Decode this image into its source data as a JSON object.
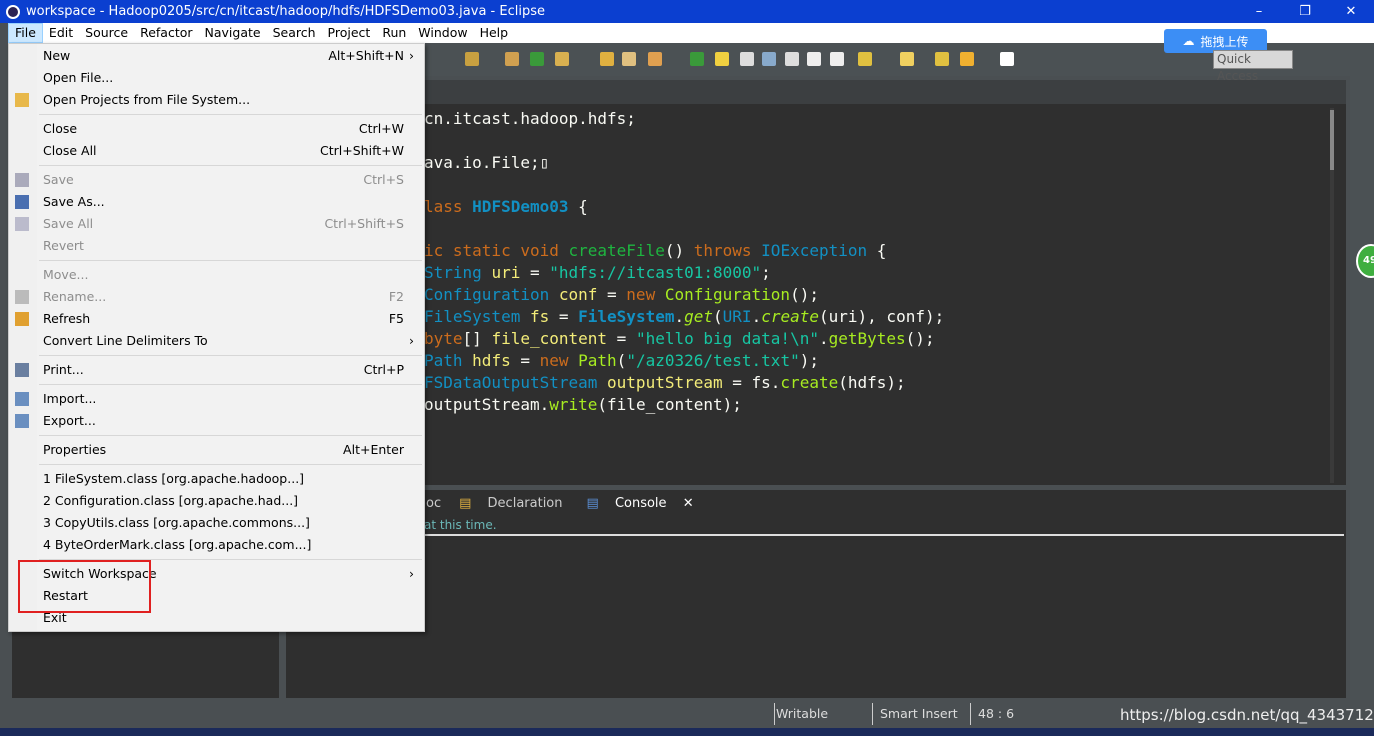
{
  "window": {
    "title": "workspace - Hadoop0205/src/cn/itcast/hadoop/hdfs/HDFSDemo03.java - Eclipse",
    "minimize": "–",
    "maximize": "❐",
    "close": "✕"
  },
  "menubar": [
    "File",
    "Edit",
    "Source",
    "Refactor",
    "Navigate",
    "Search",
    "Project",
    "Run",
    "Window",
    "Help"
  ],
  "toolbar": {
    "quick_access": "Quick Access",
    "upload_label": "拖拽上传"
  },
  "file_menu": [
    {
      "label": "New",
      "shortcut": "Alt+Shift+N",
      "submenu": true,
      "enabled": true
    },
    {
      "label": "Open File...",
      "enabled": true
    },
    {
      "label": "Open Projects from File System...",
      "enabled": true,
      "icon": "folder-icon"
    },
    {
      "sep": true
    },
    {
      "label": "Close",
      "shortcut": "Ctrl+W",
      "enabled": true
    },
    {
      "label": "Close All",
      "shortcut": "Ctrl+Shift+W",
      "enabled": true
    },
    {
      "sep": true
    },
    {
      "label": "Save",
      "shortcut": "Ctrl+S",
      "enabled": false,
      "icon": "save-icon"
    },
    {
      "label": "Save As...",
      "enabled": true,
      "icon": "save-as-icon"
    },
    {
      "label": "Save All",
      "shortcut": "Ctrl+Shift+S",
      "enabled": false,
      "icon": "save-all-icon"
    },
    {
      "label": "Revert",
      "enabled": false
    },
    {
      "sep": true
    },
    {
      "label": "Move...",
      "enabled": false
    },
    {
      "label": "Rename...",
      "shortcut": "F2",
      "enabled": false,
      "icon": "rename-icon"
    },
    {
      "label": "Refresh",
      "shortcut": "F5",
      "enabled": true,
      "icon": "refresh-icon"
    },
    {
      "label": "Convert Line Delimiters To",
      "submenu": true,
      "enabled": true
    },
    {
      "sep": true
    },
    {
      "label": "Print...",
      "shortcut": "Ctrl+P",
      "enabled": true,
      "icon": "print-icon"
    },
    {
      "sep": true
    },
    {
      "label": "Import...",
      "enabled": true,
      "icon": "import-icon"
    },
    {
      "label": "Export...",
      "enabled": true,
      "icon": "export-icon"
    },
    {
      "sep": true
    },
    {
      "label": "Properties",
      "shortcut": "Alt+Enter",
      "enabled": true
    },
    {
      "sep": true
    },
    {
      "label": "1 FileSystem.class  [org.apache.hadoop...]",
      "enabled": true
    },
    {
      "label": "2 Configuration.class  [org.apache.had...]",
      "enabled": true
    },
    {
      "label": "3 CopyUtils.class  [org.apache.commons...]",
      "enabled": true
    },
    {
      "label": "4 ByteOrderMark.class  [org.apache.com...]",
      "enabled": true
    },
    {
      "sep": true
    },
    {
      "label": "Switch Workspace",
      "submenu": true,
      "enabled": true
    },
    {
      "label": "Restart",
      "enabled": true
    },
    {
      "label": "Exit",
      "enabled": true
    }
  ],
  "editor": {
    "lines": [
      [
        [
          "cn.itcast.hadoop.hdfs;",
          ""
        ]
      ],
      [],
      [
        [
          "ava.io.File;",
          ""
        ],
        [
          "▯",
          ""
        ]
      ],
      [],
      [
        [
          "lass ",
          "k"
        ],
        [
          "HDFSDemo03",
          "t b"
        ],
        [
          " {",
          ""
        ]
      ],
      [],
      [
        [
          "ic static void ",
          "k"
        ],
        [
          "createFile",
          "m"
        ],
        [
          "() ",
          ""
        ],
        [
          "throws ",
          "k"
        ],
        [
          "IOException",
          "t"
        ],
        [
          " {",
          ""
        ]
      ],
      [
        [
          "String ",
          "t"
        ],
        [
          "uri",
          "l"
        ],
        [
          " = ",
          ""
        ],
        [
          "\"hdfs://itcast01:8000\"",
          "s"
        ],
        [
          ";",
          ""
        ]
      ],
      [
        [
          "Configuration ",
          "t"
        ],
        [
          "conf",
          "l"
        ],
        [
          " = ",
          ""
        ],
        [
          "new ",
          "k"
        ],
        [
          "Configuration",
          "c"
        ],
        [
          "();",
          ""
        ]
      ],
      [
        [
          "FileSystem ",
          "t"
        ],
        [
          "fs",
          "l"
        ],
        [
          " = ",
          ""
        ],
        [
          "FileSystem",
          "t b"
        ],
        [
          ".",
          ""
        ],
        [
          "get",
          "c i"
        ],
        [
          "(",
          ""
        ],
        [
          "URI",
          "t"
        ],
        [
          ".",
          ""
        ],
        [
          "create",
          "c i"
        ],
        [
          "(uri), conf);",
          ""
        ]
      ],
      [
        [
          "byte",
          "k"
        ],
        [
          "[] ",
          ""
        ],
        [
          "file_content",
          "l"
        ],
        [
          " = ",
          ""
        ],
        [
          "\"hello big data!\\n\"",
          "s"
        ],
        [
          ".",
          ""
        ],
        [
          "getBytes",
          "c"
        ],
        [
          "();",
          ""
        ]
      ],
      [
        [
          "Path ",
          "t"
        ],
        [
          "hdfs",
          "l"
        ],
        [
          " = ",
          ""
        ],
        [
          "new ",
          "k"
        ],
        [
          "Path",
          "c"
        ],
        [
          "(",
          ""
        ],
        [
          "\"/az0326/test.txt\"",
          "s"
        ],
        [
          ");",
          ""
        ]
      ],
      [
        [
          "FSDataOutputStream ",
          "t"
        ],
        [
          "outputStream",
          "l"
        ],
        [
          " = fs.",
          ""
        ],
        [
          "create",
          "c"
        ],
        [
          "(hdfs);",
          ""
        ]
      ],
      [
        [
          "outputStream.",
          ""
        ],
        [
          "write",
          "c"
        ],
        [
          "(file_content);",
          ""
        ]
      ]
    ]
  },
  "bottom_panel": {
    "tabs": [
      "oc",
      "Declaration",
      "Console"
    ],
    "active": "Console",
    "console_message": "at this time."
  },
  "status": {
    "writable": "Writable",
    "insert_mode": "Smart Insert",
    "position": "48 : 6"
  },
  "watermark": "https://blog.csdn.net/qq_4343712",
  "side_badge": "49"
}
